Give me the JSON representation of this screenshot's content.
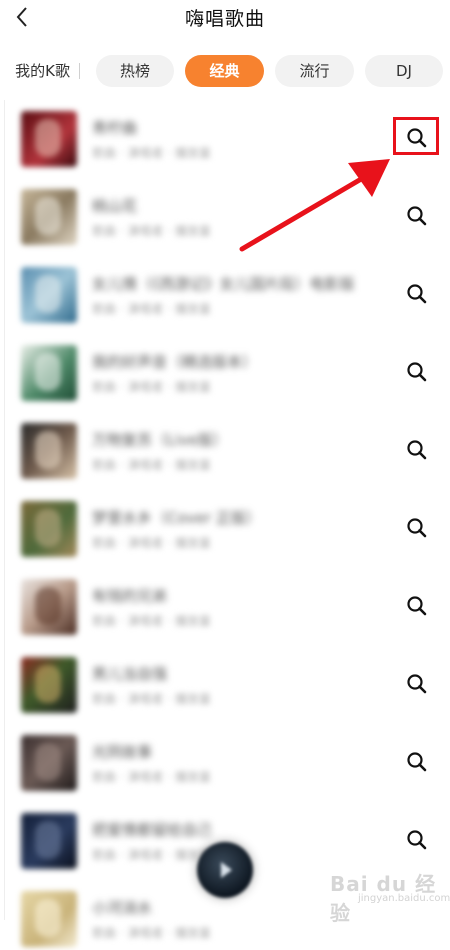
{
  "header": {
    "title": "嗨唱歌曲",
    "back_icon": "chevron-left-icon"
  },
  "tabs": [
    {
      "label": "我的K歌",
      "active": false
    },
    {
      "label": "热榜",
      "active": false
    },
    {
      "label": "经典",
      "active": true
    },
    {
      "label": "流行",
      "active": false
    },
    {
      "label": "DJ",
      "active": false
    }
  ],
  "colors": {
    "accent": "#f7822f",
    "annotation": "#e8121b"
  },
  "songs": [
    {
      "title": "青柠曲",
      "subtitle": "歌曲 · 演唱者 · 播放量"
    },
    {
      "title": "桃山花",
      "subtitle": "歌曲 · 演唱者 · 播放量"
    },
    {
      "title": "女儿情（《西游记》女儿国片段）电影版",
      "subtitle": "歌曲 · 演唱者 · 播放量"
    },
    {
      "title": "我的好声音（精选版本）",
      "subtitle": "歌曲 · 演唱者 · 播放量"
    },
    {
      "title": "万物复苏（Live版）",
      "subtitle": "歌曲 · 演唱者 · 播放量"
    },
    {
      "title": "梦里水乡（Cover 正版）",
      "subtitle": "歌曲 · 演唱者 · 播放量"
    },
    {
      "title": "有钱的兄弟",
      "subtitle": "歌曲 · 演唱者 · 播放量"
    },
    {
      "title": "男儿当自强",
      "subtitle": "歌曲 · 演唱者 · 播放量"
    },
    {
      "title": "光阴故事",
      "subtitle": "歌曲 · 演唱者 · 播放量"
    },
    {
      "title": "把爱情都留给自己",
      "subtitle": "歌曲 · 演唱者 · 播放量"
    },
    {
      "title": "小河淌水",
      "subtitle": "歌曲 · 演唱者 · 播放量"
    }
  ],
  "row_icon": "search-icon",
  "watermark": {
    "text": "Bai du 经验",
    "sub": "jingyan.baidu.com"
  }
}
